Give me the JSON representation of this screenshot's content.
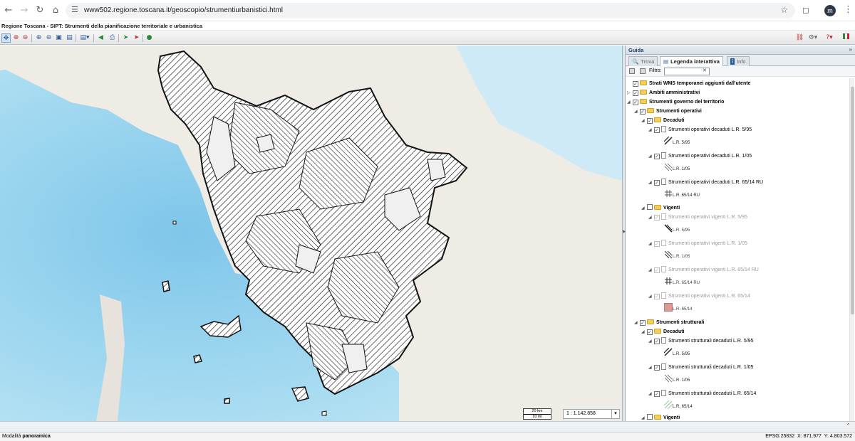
{
  "browser": {
    "url": "www502.regione.toscana.it/geoscopio/strumentiurbanistici.html",
    "profile_initial": "m",
    "icons": [
      "back-icon",
      "forward-icon",
      "reload-icon",
      "home-icon",
      "site-info-icon",
      "bookmark-star-icon",
      "extensions-icon",
      "menu-icon"
    ]
  },
  "app": {
    "title": "Regione Toscana - SIPT: Strumenti della pianificazione territoriale e urbanistica"
  },
  "map": {
    "scale_km": "20 km",
    "scale_mi": "10 mi",
    "scale_value": "1 : 1.142.858"
  },
  "panel": {
    "title": "Guida",
    "tabs": [
      "Trova",
      "Legenda interattiva",
      "Info"
    ],
    "active_tab": "Legenda interattiva",
    "filter_label": "Filtro:",
    "filter_value": "",
    "tree": [
      {
        "label": "Strati WMS temporanei aggiunti dall'utente",
        "bold": true
      },
      {
        "label": "Ambiti amministrativi",
        "bold": true
      },
      {
        "label": "Strumenti governo del territorio",
        "bold": true
      },
      {
        "label": "Strumenti operativi",
        "bold": true
      },
      {
        "label": "Decaduti",
        "bold": true
      },
      {
        "label": "Strumenti operativi decaduti L.R. 5/95",
        "symbol": "L.R. 5/95"
      },
      {
        "label": "Strumenti operativi decaduti L.R. 1/05",
        "symbol": "L.R. 1/05"
      },
      {
        "label": "Strumenti operativi decaduti L.R. 65/14 RU",
        "symbol": "L.R. 65/14 RU"
      },
      {
        "label": "Vigenti",
        "bold": true
      },
      {
        "label": "Strumenti operativi vigenti L.R. 5/95",
        "symbol": "L.R. 5/95"
      },
      {
        "label": "Strumenti operativi vigenti L.R. 1/05",
        "symbol": "L.R. 1/05"
      },
      {
        "label": "Strumenti operativi vigenti L.R. 65/14 RU",
        "symbol": "L.R. 65/14 RU"
      },
      {
        "label": "Strumenti operativi vigenti L.R. 65/14",
        "symbol": "L.R. 65/14"
      },
      {
        "label": "Strumenti strutturali",
        "bold": true
      },
      {
        "label": "Decaduti",
        "bold": true
      },
      {
        "label": "Strumenti strutturali decaduti L.R. 5/95",
        "symbol": "L.R. 5/95"
      },
      {
        "label": "Strumenti strutturali decaduti L.R. 1/05",
        "symbol": "L.R. 1/05"
      },
      {
        "label": "Strumenti strutturali decaduti L.R. 65/14",
        "symbol": "L.R. 65/14"
      },
      {
        "label": "Vigenti",
        "bold": true
      }
    ],
    "symbol_colors": {
      "vigenti_65_14": "#d99a9a",
      "hatch": "#222222",
      "hatch_light": "#9cc79c"
    }
  },
  "status": {
    "mode_label": "Modalità",
    "mode_value": "panoramica",
    "epsg": "EPSG:25832",
    "x_label": "X:",
    "x_value": "871.977",
    "y_label": "Y:",
    "y_value": "4.803.572"
  }
}
